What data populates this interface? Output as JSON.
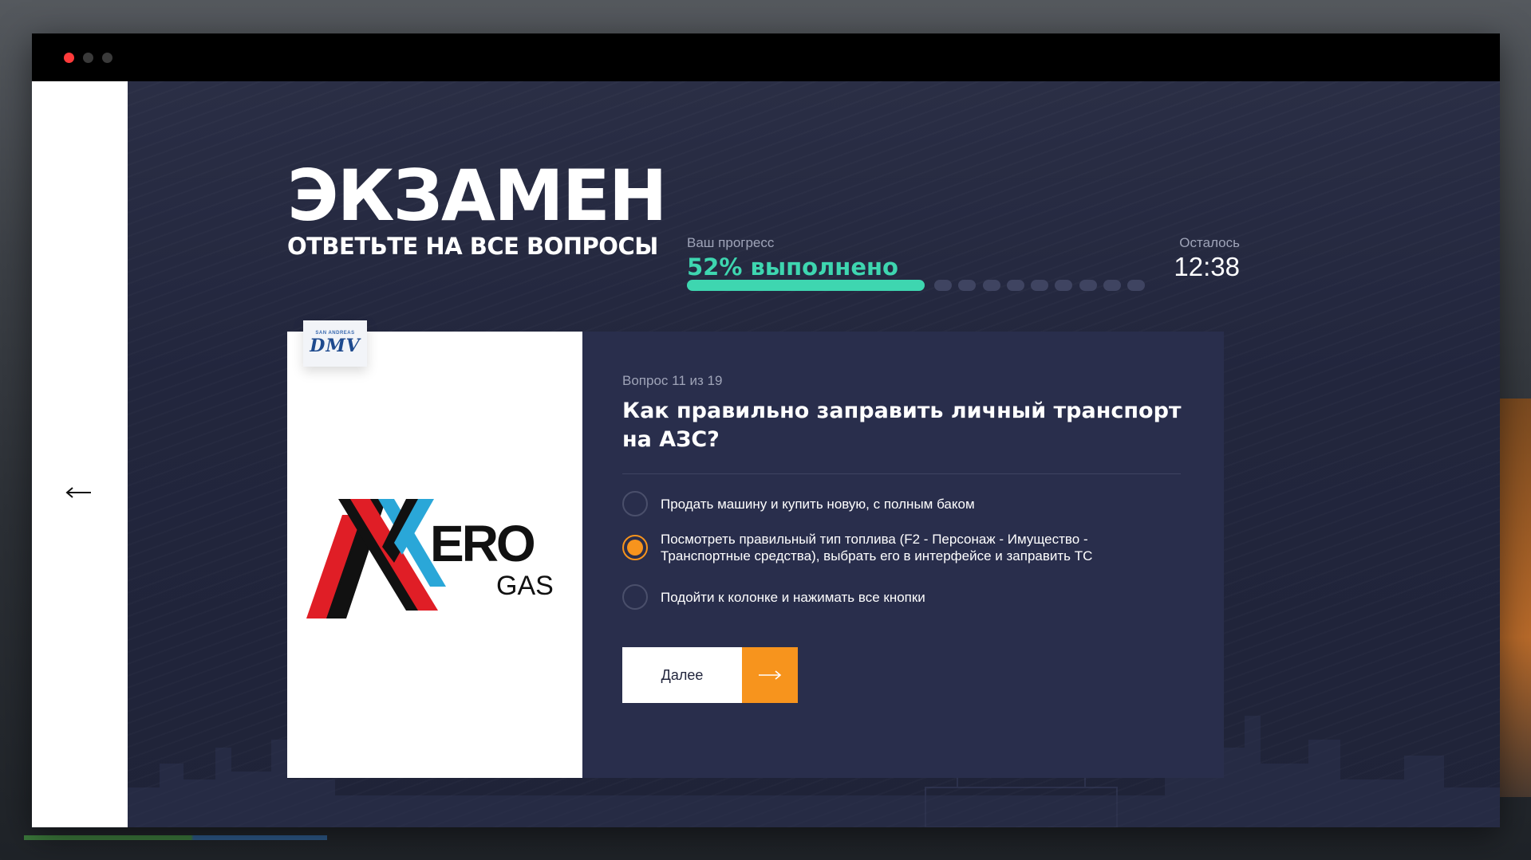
{
  "exam": {
    "title": "ЭКЗАМЕН",
    "subtitle": "ОТВЕТЬТЕ НА ВСЕ ВОПРОСЫ"
  },
  "progress": {
    "label": "Ваш прогресс",
    "value_text": "52% выполнено",
    "percent": 52,
    "remaining_segments": 9
  },
  "timer": {
    "label": "Осталось",
    "value": "12:38"
  },
  "image_card": {
    "badge_small": "SAN ANDREAS",
    "badge_text": "DMV",
    "logo_primary": "ERO",
    "logo_secondary": "GAS"
  },
  "question": {
    "meta": "Вопрос 11 из 19",
    "text": "Как правильно заправить личный транспорт на АЗС?",
    "options": [
      {
        "label": "Продать машину и купить новую, с полным баком",
        "selected": false
      },
      {
        "label": "Посмотреть правильный тип топлива (F2 - Персонаж - Имущество - Транспортные средства), выбрать его в интерфейсе и заправить ТС",
        "selected": true
      },
      {
        "label": "Подойти к колонке и нажимать все кнопки",
        "selected": false
      }
    ]
  },
  "buttons": {
    "next_label": "Далее"
  },
  "colors": {
    "accent_green": "#3ed6b0",
    "accent_orange": "#f7941d",
    "panel_bg": "#292e4c",
    "window_bg": "#22263d"
  },
  "icons": {
    "back": "arrow-left-icon",
    "next": "arrow-right-icon"
  }
}
